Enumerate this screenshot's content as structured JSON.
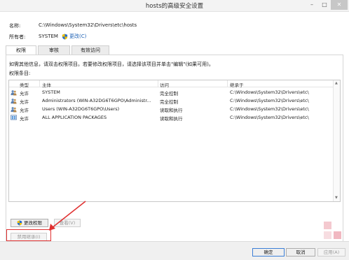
{
  "window": {
    "title": "hosts的高级安全设置"
  },
  "window_buttons": {
    "minimize": "–",
    "maximize": "□",
    "close": "✕"
  },
  "header": {
    "name_label": "名称:",
    "name_value": "C:\\Windows\\System32\\Drivers\\etc\\hosts",
    "owner_label": "所有者:",
    "owner_value": "SYSTEM",
    "change_owner_link": "更改(C)"
  },
  "tabs": [
    {
      "label": "权限",
      "active": true
    },
    {
      "label": "审核",
      "active": false
    },
    {
      "label": "有效访问",
      "active": false
    }
  ],
  "panel": {
    "info_text": "如需其他信息，请双击权限项目。若要修改权限项目，请选择该项目并单击\"编辑\"(如果可用)。",
    "entries_label": "权限条目:"
  },
  "table": {
    "columns": [
      "类型",
      "主体",
      "访问",
      "继承于"
    ],
    "rows": [
      {
        "type": "允许",
        "principal": "SYSTEM",
        "access": "完全控制",
        "inherited_from": "C:\\Windows\\System32\\Drivers\\etc\\",
        "icon": "user-group-icon"
      },
      {
        "type": "允许",
        "principal": "Administrators (WIN-A32DG6T6GPO\\Administr...",
        "access": "完全控制",
        "inherited_from": "C:\\Windows\\System32\\Drivers\\etc\\",
        "icon": "user-group-icon"
      },
      {
        "type": "允许",
        "principal": "Users (WIN-A32DG6T6GPO\\Users)",
        "access": "读取和执行",
        "inherited_from": "C:\\Windows\\System32\\Drivers\\etc\\",
        "icon": "user-group-icon"
      },
      {
        "type": "允许",
        "principal": "ALL APPLICATION PACKAGES",
        "access": "读取和执行",
        "inherited_from": "C:\\Windows\\System32\\Drivers\\etc\\",
        "icon": "app-package-icon"
      }
    ]
  },
  "buttons": {
    "change_permissions": "更改权限",
    "view": "查看(V)",
    "disable_inheritance": "禁用继承(I)"
  },
  "footer": {
    "ok": "确定",
    "cancel": "取消",
    "apply": "应用(A)"
  },
  "colors": {
    "annotation_red": "#e03030",
    "shield_blue": "#2a6fc9",
    "shield_yellow": "#f2c200"
  }
}
